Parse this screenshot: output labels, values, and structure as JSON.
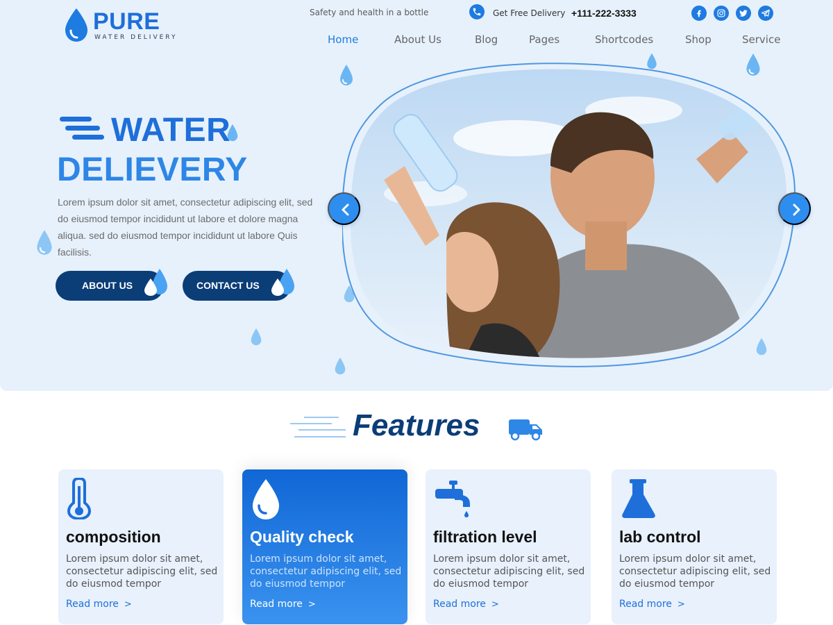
{
  "brand": {
    "name": "PURE",
    "subtitle": "WATER DELIVERY",
    "accent": "#1e6fd9",
    "dark": "#0b3d77"
  },
  "topbar": {
    "tagline": "Safety and health in a bottle",
    "delivery_label": "Get Free Delivery",
    "phone": "+111-222-3333",
    "socials": [
      "facebook-icon",
      "instagram-icon",
      "twitter-icon",
      "telegram-icon"
    ]
  },
  "nav": {
    "items": [
      "Home",
      "About Us",
      "Blog",
      "Pages",
      "Shortcodes",
      "Shop",
      "Service"
    ],
    "active": "Home"
  },
  "hero": {
    "title_line1": "WATER",
    "title_line2": "DELIEVERY",
    "text": "Lorem ipsum dolor sit amet, consectetur adipiscing elit, sed do eiusmod tempor incididunt ut labore et dolore magna aliqua. sed do eiusmod tempor incididunt ut labore Quis  facilisis.",
    "about_button": "ABOUT US",
    "contact_button": "CONTACT US",
    "slider": {
      "prev": "chevron-left-icon",
      "next": "chevron-right-icon"
    }
  },
  "features": {
    "heading": "Features",
    "cards": [
      {
        "title": "composition",
        "text": "Lorem ipsum dolor sit amet, consectetur adipiscing elit, sed do eiusmod tempor",
        "link": "Read more",
        "icon": "thermometer-icon"
      },
      {
        "title": "Quality check",
        "text": "Lorem ipsum dolor sit amet, consectetur adipiscing elit, sed do eiusmod tempor",
        "link": "Read more",
        "icon": "water-drop-icon"
      },
      {
        "title": "filtration level",
        "text": "Lorem ipsum dolor sit amet, consectetur adipiscing elit, sed do eiusmod tempor",
        "link": "Read more",
        "icon": "water-tap-icon"
      },
      {
        "title": "lab control",
        "text": "Lorem ipsum dolor sit amet, consectetur adipiscing elit, sed do eiusmod tempor",
        "link": "Read more",
        "icon": "flask-icon"
      }
    ]
  }
}
